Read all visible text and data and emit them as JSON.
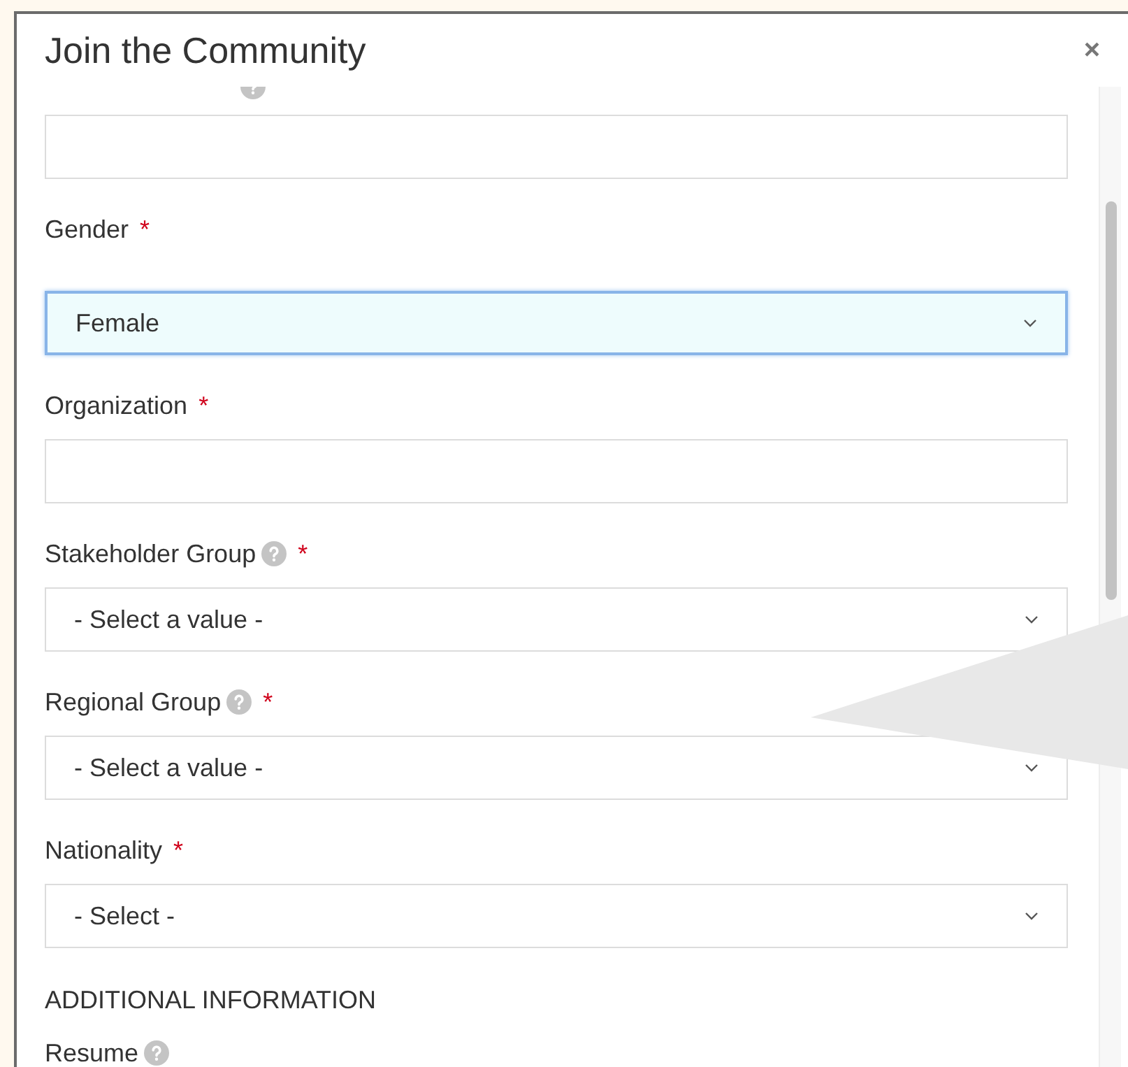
{
  "dialog": {
    "title": "Join the Community",
    "close": "×"
  },
  "fields": [
    {
      "kind": "text",
      "help": true
    },
    {
      "kind": "select",
      "label": "Gender",
      "required": true,
      "value": "Female",
      "focused": true
    },
    {
      "kind": "text",
      "label": "Organization",
      "required": true
    },
    {
      "kind": "select",
      "label": "Stakeholder Group",
      "help": true,
      "required": true,
      "value": "- Select a value -",
      "focused": false
    },
    {
      "kind": "select",
      "label": "Regional Group",
      "help": true,
      "required": true,
      "value": "- Select a value -",
      "focused": false
    },
    {
      "kind": "select",
      "label": "Nationality",
      "required": true,
      "value": "- Select -",
      "focused": false
    },
    {
      "kind": "heading",
      "label": "ADDITIONAL INFORMATION"
    },
    {
      "kind": "label",
      "label": "Resume",
      "help": true
    }
  ],
  "required_mark": "*"
}
